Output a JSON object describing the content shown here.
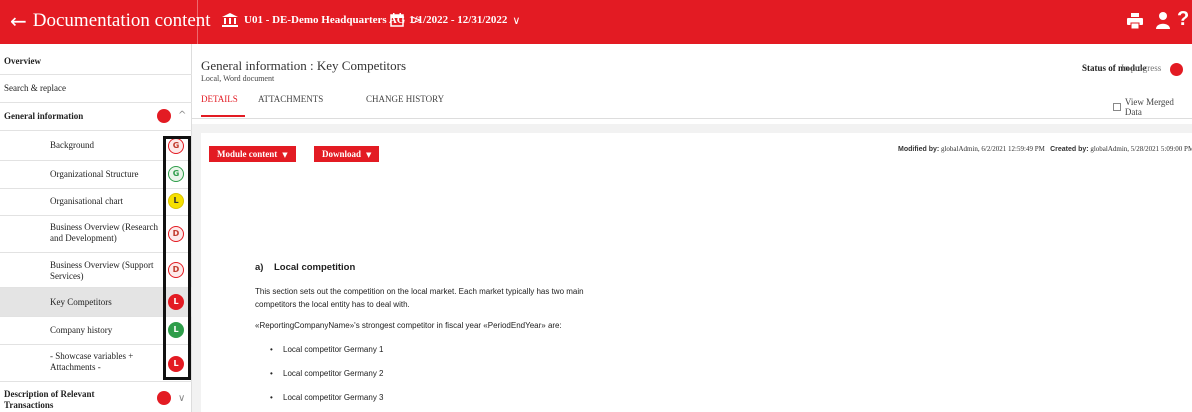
{
  "topbar": {
    "back_label": "Documentation content",
    "entity": "U01 - DE-Demo Headquarters AG",
    "entity_chevron": ">",
    "period": "1/1/2022 - 12/31/2022",
    "period_chevron": "∨"
  },
  "sidebar": {
    "overview": "Overview",
    "search_replace": "Search & replace",
    "general_info": "General information",
    "items": [
      {
        "label": "Background",
        "badge": "G",
        "badge_style": "outline-red"
      },
      {
        "label": "Organizational Structure",
        "badge": "G",
        "badge_style": "outline-green"
      },
      {
        "label": "Organisational chart",
        "badge": "L",
        "badge_style": "yellow"
      },
      {
        "label": "Business Overview (Research and Development)",
        "badge": "D",
        "badge_style": "outline-red"
      },
      {
        "label": "Business Overview (Support Services)",
        "badge": "D",
        "badge_style": "outline-red"
      },
      {
        "label": "Key Competitors",
        "badge": "L",
        "badge_style": "red"
      },
      {
        "label": "Company history",
        "badge": "L",
        "badge_style": "green"
      },
      {
        "label": "- Showcase variables + Attachments -",
        "badge": "L",
        "badge_style": "red"
      }
    ],
    "relevant_transactions": "Description of Relevant Transactions"
  },
  "main": {
    "title": "General information : Key Competitors",
    "subtitle": "Local, Word document",
    "status_label": "Status of module",
    "status_value": "In progress",
    "tabs": [
      "DETAILS",
      "ATTACHMENTS",
      "CHANGE HISTORY"
    ],
    "view_merged": "View Merged Data",
    "btn_module": "Module content",
    "btn_download": "Download",
    "modified_label": "Modified by:",
    "modified_value": "globalAdmin, 6/2/2021 12:59:49 PM",
    "created_label": "Created by:",
    "created_value": "globalAdmin, 5/28/2021 5:09:00 PM"
  },
  "document": {
    "heading": "a)    Local competition",
    "para1_line1": "This section sets out the competition on the local market. Each market typically has two main",
    "para1_line2": "competitors the local entity has to deal with.",
    "para2": "«ReportingCompanyName»'s strongest competitor in fiscal year «PeriodEndYear» are:",
    "bullets": [
      "Local competitor Germany 1",
      "Local competitor Germany 2",
      "Local competitor Germany 3"
    ]
  },
  "colors": {
    "brand_red": "#e31b23",
    "status_green": "#2e9d4a",
    "status_yellow": "#f5df00"
  }
}
